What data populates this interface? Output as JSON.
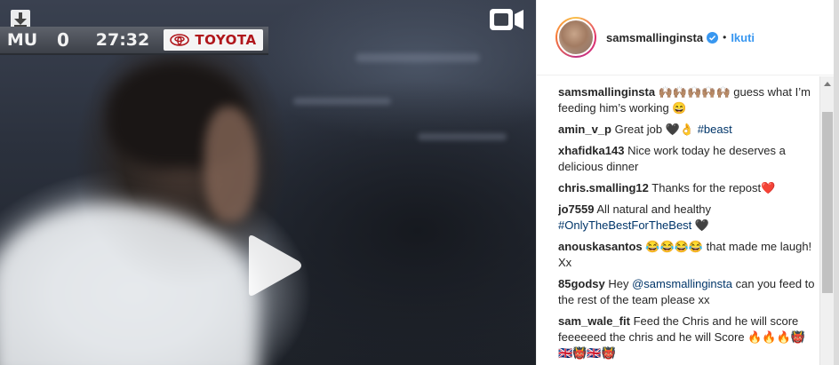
{
  "video": {
    "scoreboard": {
      "team": "MU",
      "score": "0",
      "clock": "27:32",
      "sponsor": "TOYOTA"
    },
    "icons": {
      "download": "download-arrow-icon",
      "camera": "video-camera-icon",
      "play": "play-icon"
    }
  },
  "header": {
    "username": "samsmallinginsta",
    "dot": "•",
    "follow_label": "Ikuti"
  },
  "comments": [
    {
      "user": "samsmallinginsta",
      "parts": [
        {
          "t": "🙌🏽🙌🏽🙌🏽🙌🏽🙌🏽 guess what I’m feeding him’s working 😄"
        }
      ]
    },
    {
      "user": "amin_v_p",
      "parts": [
        {
          "t": "Great job 🖤👌 "
        },
        {
          "t": "#beast",
          "link": true
        }
      ]
    },
    {
      "user": "xhafidka143",
      "parts": [
        {
          "t": "Nice work today he deserves a delicious dinner"
        }
      ]
    },
    {
      "user": "chris.smalling12",
      "parts": [
        {
          "t": "Thanks for the repost❤️"
        }
      ]
    },
    {
      "user": "jo7559",
      "parts": [
        {
          "t": "All natural and healthy "
        },
        {
          "t": "#OnlyTheBestForTheBest",
          "link": true
        },
        {
          "t": " 🖤"
        }
      ]
    },
    {
      "user": "anouskasantos",
      "parts": [
        {
          "t": "😂😂😂😂 that made me laugh! Xx"
        }
      ]
    },
    {
      "user": "85godsy",
      "parts": [
        {
          "t": "Hey "
        },
        {
          "t": "@samsmallinginsta",
          "link": true
        },
        {
          "t": " can you feed to the rest of the team please xx"
        }
      ]
    },
    {
      "user": "sam_wale_fit",
      "parts": [
        {
          "t": "Feed the Chris and he will score feeeeeed the chris and he will Score 🔥🔥🔥👹🇬🇧👹🇬🇧👹"
        }
      ]
    }
  ],
  "colors": {
    "accent": "#3897f0",
    "verified": "#3897f0",
    "hashtag": "#003569",
    "sponsor_red": "#b0161b"
  }
}
